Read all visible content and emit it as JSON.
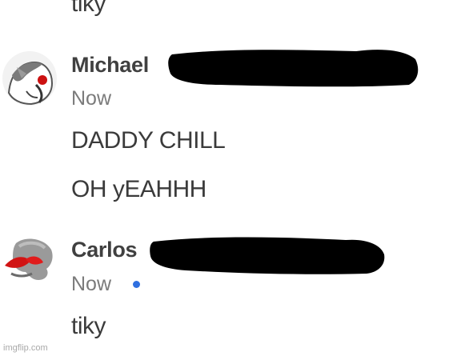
{
  "chat": {
    "previous_message": "tiky",
    "messages": [
      {
        "author": "Michael",
        "time": "Now",
        "lines": [
          "DADDY CHILL",
          "OH yEAHHH"
        ]
      },
      {
        "author": "Carlos",
        "time": "Now",
        "lines": [
          "tiky"
        ]
      }
    ],
    "unread_dot_color": "#2f6fe0",
    "redaction_color": "#000000"
  },
  "watermark": "imgflip.com"
}
